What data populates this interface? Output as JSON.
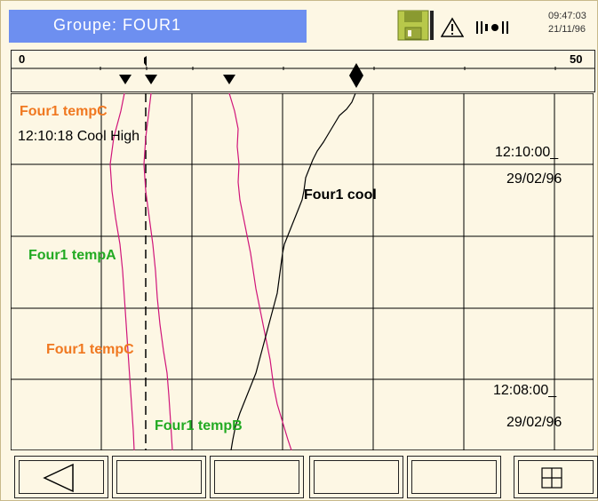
{
  "header": {
    "title": "Groupe:  FOUR1",
    "time": "09:47:03",
    "date": "21/11/96",
    "icons": [
      "floppy-disk-icon",
      "warning-triangle-icon",
      "signal-bars-icon"
    ]
  },
  "scale": {
    "min_label": "0",
    "max_label": "50"
  },
  "chart": {
    "event_text": "12:10:18  Cool  High",
    "timestamp_top_time": "12:10:00_",
    "timestamp_top_date": "29/02/96",
    "timestamp_bottom_time": "12:08:00_",
    "timestamp_bottom_date": "29/02/96",
    "labels": [
      {
        "text": "Four1   tempC",
        "color": "#f07820"
      },
      {
        "text": "Four1    cool",
        "color": "#000000"
      },
      {
        "text": "Four1   tempA",
        "color": "#22aa22"
      },
      {
        "text": "Four1   tempC",
        "color": "#f07820"
      },
      {
        "text": "Four1   tempB",
        "color": "#22aa22"
      }
    ]
  },
  "softkeys": [
    "back-arrow-icon",
    "",
    "",
    "",
    "",
    "grid-layout-icon"
  ],
  "colors": {
    "title_bar": "#6d8ff0",
    "background": "#fdf7e4",
    "trace_magenta": "#d0157a",
    "trace_black": "#000000"
  }
}
